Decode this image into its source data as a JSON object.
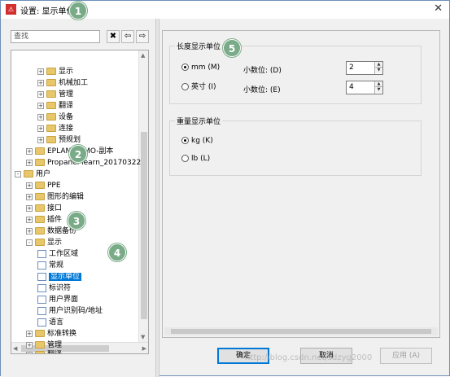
{
  "window": {
    "title": "设置: 显示单位",
    "app_icon_glyph": "⚠",
    "close_glyph": "✕"
  },
  "badges": [
    "1",
    "2",
    "3",
    "4",
    "5"
  ],
  "search": {
    "placeholder": "查找"
  },
  "toolbar": {
    "btn1": "✖",
    "btn2": "⇦",
    "btn3": "⇨"
  },
  "tree": {
    "rows": [
      {
        "label": "显示",
        "expander": "+",
        "icon": "folder"
      },
      {
        "label": "机械加工",
        "expander": "+",
        "icon": "folder"
      },
      {
        "label": "管理",
        "expander": "+",
        "icon": "folder"
      },
      {
        "label": "翻译",
        "expander": "+",
        "icon": "folder"
      },
      {
        "label": "设备",
        "expander": "+",
        "icon": "folder"
      },
      {
        "label": "连接",
        "expander": "+",
        "icon": "folder"
      },
      {
        "label": "预规划",
        "expander": "+",
        "icon": "folder"
      },
      {
        "label": "EPLAN-DEMO-副本",
        "expander": "+",
        "icon": "folder"
      },
      {
        "label": "Propanel learn_20170322",
        "expander": "+",
        "icon": "folder"
      },
      {
        "label": "用户",
        "expander": "-",
        "icon": "folder"
      },
      {
        "label": "PPE",
        "expander": "+",
        "icon": "folder"
      },
      {
        "label": "图形的编辑",
        "expander": "+",
        "icon": "folder"
      },
      {
        "label": "接口",
        "expander": "+",
        "icon": "folder"
      },
      {
        "label": "插件",
        "expander": "+",
        "icon": "folder"
      },
      {
        "label": "数据备份",
        "expander": "+",
        "icon": "folder"
      },
      {
        "label": "显示",
        "expander": "-",
        "icon": "folder"
      },
      {
        "label": "工作区域",
        "expander": "",
        "icon": "page"
      },
      {
        "label": "常规",
        "expander": "",
        "icon": "page"
      },
      {
        "label": "显示单位",
        "expander": "",
        "icon": "page",
        "selected": true
      },
      {
        "label": "标识符",
        "expander": "",
        "icon": "page"
      },
      {
        "label": "用户界面",
        "expander": "",
        "icon": "page"
      },
      {
        "label": "用户识别码/地址",
        "expander": "",
        "icon": "page"
      },
      {
        "label": "语言",
        "expander": "",
        "icon": "page"
      },
      {
        "label": "标准转换",
        "expander": "+",
        "icon": "folder"
      },
      {
        "label": "管理",
        "expander": "+",
        "icon": "folder"
      },
      {
        "label": "翻译",
        "expander": "+",
        "icon": "folder"
      }
    ]
  },
  "length_group": {
    "title": "长度显示单位",
    "mm_label": "mm (M)",
    "inch_label": "英寸 (I)",
    "decimals_d_label": "小数位: (D)",
    "decimals_d_value": "2",
    "decimals_e_label": "小数位: (E)",
    "decimals_e_value": "4",
    "selected": "mm"
  },
  "weight_group": {
    "title": "重量显示单位",
    "kg_label": "kg (K)",
    "lb_label": "lb (L)",
    "selected": "kg"
  },
  "buttons": {
    "ok": "确定",
    "cancel": "取消",
    "apply": "应用 (A)"
  },
  "watermark": "http://blog.csdn.net/sdzyg2000"
}
